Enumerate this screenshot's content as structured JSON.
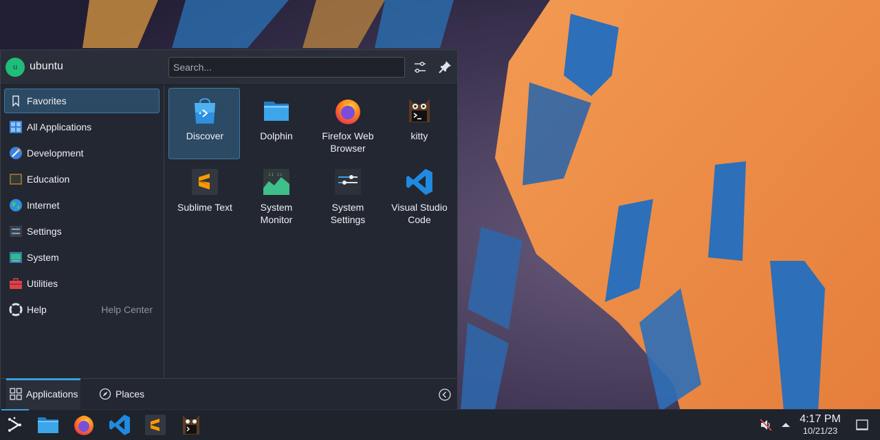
{
  "user": {
    "name": "ubuntu",
    "initial": "u"
  },
  "search": {
    "placeholder": "Search..."
  },
  "sidebar": {
    "items": [
      {
        "label": "Favorites",
        "icon": "bookmark-icon"
      },
      {
        "label": "All Applications",
        "icon": "grid-icon"
      },
      {
        "label": "Development",
        "icon": "development-icon"
      },
      {
        "label": "Education",
        "icon": "education-icon"
      },
      {
        "label": "Internet",
        "icon": "globe-icon"
      },
      {
        "label": "Settings",
        "icon": "settings-icon"
      },
      {
        "label": "System",
        "icon": "system-icon"
      },
      {
        "label": "Utilities",
        "icon": "toolbox-icon"
      },
      {
        "label": "Help",
        "icon": "lifebuoy-icon",
        "hint": "Help Center"
      }
    ]
  },
  "apps": [
    {
      "label": "Discover",
      "icon": "discover-icon"
    },
    {
      "label": "Dolphin",
      "icon": "folder-icon"
    },
    {
      "label": "Firefox Web\nBrowser",
      "icon": "firefox-icon"
    },
    {
      "label": "kitty",
      "icon": "kitty-icon"
    },
    {
      "label": "Sublime Text",
      "icon": "sublime-text-icon"
    },
    {
      "label": "System\nMonitor",
      "icon": "system-monitor-icon"
    },
    {
      "label": "System\nSettings",
      "icon": "system-settings-icon"
    },
    {
      "label": "Visual Studio\nCode",
      "icon": "vscode-icon"
    }
  ],
  "footer": {
    "applications_label": "Applications",
    "places_label": "Places"
  },
  "taskbar": {
    "items": [
      "launcher-icon",
      "folder-icon",
      "firefox-icon",
      "vscode-icon",
      "sublime-text-icon",
      "kitty-icon"
    ]
  },
  "clock": {
    "time": "4:17 PM",
    "date": "10/21/23"
  },
  "colors": {
    "accent": "#3d9ee0",
    "panel": "#232731",
    "taskbar": "#1f232b"
  }
}
